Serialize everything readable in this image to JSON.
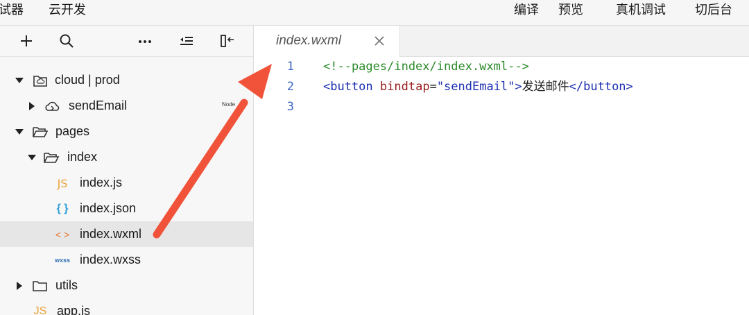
{
  "menubar": {
    "left": [
      "试器",
      "云开发"
    ],
    "right": [
      "编译",
      "预览",
      "真机调试",
      "切后台"
    ]
  },
  "toolbar_icons": [
    "plus-icon",
    "search-icon",
    "more-icon",
    "outdent-icon",
    "collapse-panel-icon"
  ],
  "tree": [
    {
      "label": "cloud | prod",
      "icon": "cloud-folder-icon",
      "expanded": true
    },
    {
      "label": "sendEmail",
      "icon": "cloud-function-icon",
      "expanded": false,
      "badge": "Node"
    },
    {
      "label": "pages",
      "icon": "folder-open-icon",
      "expanded": true
    },
    {
      "label": "index",
      "icon": "folder-open-icon",
      "expanded": true
    },
    {
      "label": "index.js",
      "icon": "js-file-icon",
      "glyph": "JS"
    },
    {
      "label": "index.json",
      "icon": "json-file-icon",
      "glyph": "{ }"
    },
    {
      "label": "index.wxml",
      "icon": "wxml-file-icon",
      "glyph": "< >",
      "selected": true
    },
    {
      "label": "index.wxss",
      "icon": "wxss-file-icon",
      "glyph": "wxss"
    },
    {
      "label": "utils",
      "icon": "folder-icon",
      "expanded": false
    },
    {
      "label": "app.js",
      "icon": "js-file-icon",
      "glyph": "JS"
    }
  ],
  "editor": {
    "tab_title": "index.wxml",
    "lines": [
      {
        "num": "1",
        "comment": "<!--pages/index/index.wxml-->"
      },
      {
        "num": "2",
        "open": "<button",
        "attr": "bindtap",
        "eq": "=",
        "value": "\"sendEmail\"",
        "close": ">",
        "text": "发送邮件",
        "end": "</button>"
      },
      {
        "num": "3"
      }
    ]
  },
  "colors": {
    "arrow": "#f0533a",
    "comment": "#2a8a2a",
    "tag": "#1b2fb0",
    "attr": "#9a1b1b",
    "line_number": "#3b66c4"
  }
}
